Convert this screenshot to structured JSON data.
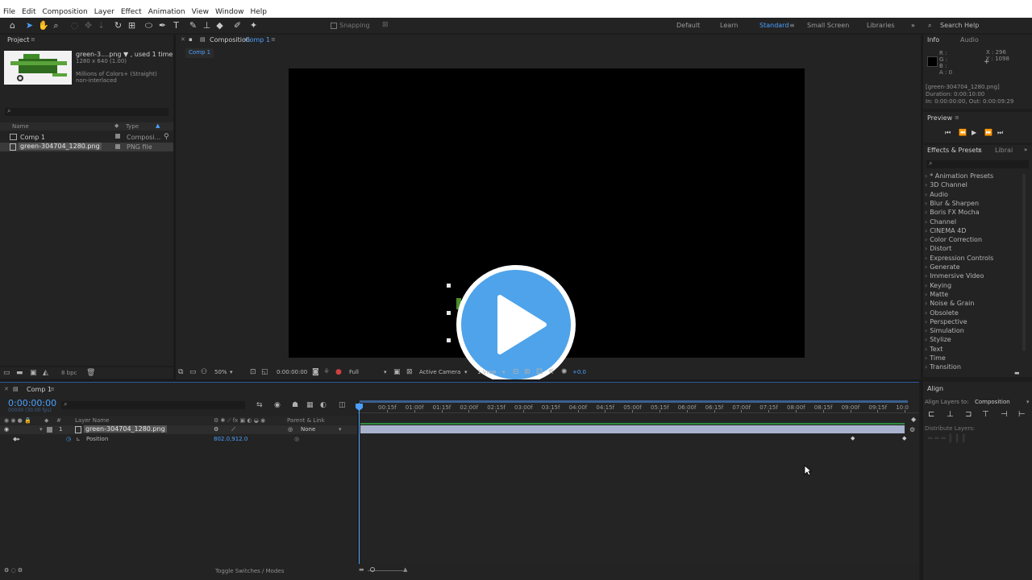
{
  "menu": [
    "File",
    "Edit",
    "Composition",
    "Layer",
    "Effect",
    "Animation",
    "View",
    "Window",
    "Help"
  ],
  "toolbar": {
    "snapping": "Snapping",
    "workspaces": [
      "Default",
      "Learn",
      "Standard",
      "Small Screen",
      "Libraries"
    ],
    "search_help": "Search Help"
  },
  "project": {
    "tab": "Project",
    "item_name": "green-3....png ▼ , used 1 time",
    "item_dims": "1280 x 640 (1.00)",
    "item_colors": "Millions of Colors+ (Straight)",
    "item_interlace": "non-interlaced",
    "col_name": "Name",
    "col_type": "Type",
    "items": [
      {
        "name": "Comp 1",
        "type": "Composi..."
      },
      {
        "name": "green-304704_1280.png",
        "type": "PNG file"
      }
    ],
    "bpc": "8 bpc"
  },
  "composition": {
    "tab_prefix": "Composition",
    "tab_name": "Comp 1",
    "breadcrumb": "Comp 1",
    "zoom": "50%",
    "timecode": "0:00:00:00",
    "resolution": "Full",
    "camera": "Active Camera",
    "view": "1 View",
    "exposure": "+0.0"
  },
  "info": {
    "tab_info": "Info",
    "tab_audio": "Audio",
    "r": "R :",
    "g": "G :",
    "b": "B :",
    "a": "A : 0",
    "x": "X : 296",
    "y": "Y : 1098",
    "file": "[green-304704_1280.png]",
    "duration": "Duration: 0:00:10:00",
    "inout": "In: 0:00:00:00, Out: 0:00:09:29"
  },
  "preview": {
    "tab": "Preview"
  },
  "effects": {
    "tab": "Effects & Presets",
    "tab2": "Librai",
    "items": [
      "* Animation Presets",
      "3D Channel",
      "Audio",
      "Blur & Sharpen",
      "Boris FX Mocha",
      "Channel",
      "CINEMA 4D",
      "Color Correction",
      "Distort",
      "Expression Controls",
      "Generate",
      "Immersive Video",
      "Keying",
      "Matte",
      "Noise & Grain",
      "Obsolete",
      "Perspective",
      "Simulation",
      "Stylize",
      "Text",
      "Time",
      "Transition"
    ]
  },
  "align": {
    "tab": "Align",
    "align_to_label": "Align Layers to:",
    "align_to_value": "Composition",
    "distribute": "Distribute Layers:"
  },
  "timeline": {
    "tab": "Comp 1",
    "timecode": "0:00:00:00",
    "timecode_sub": "00000 (30.00 fps)",
    "col_layer_name": "Layer Name",
    "col_parent": "Parent & Link",
    "layer_index": "1",
    "layer_name": "green-304704_1280.png",
    "parent_value": "None",
    "prop_name": "Position",
    "prop_value": "802.0,912.0",
    "ruler": [
      "00:15f",
      "01:00f",
      "01:15f",
      "02:00f",
      "02:15f",
      "03:00f",
      "03:15f",
      "04:00f",
      "04:15f",
      "05:00f",
      "05:15f",
      "06:00f",
      "06:15f",
      "07:00f",
      "07:15f",
      "08:00f",
      "08:15f",
      "09:00f",
      "09:15f",
      "10:0"
    ],
    "toggle_label": "Toggle Switches / Modes"
  },
  "colors": {
    "accent": "#2d8ceb",
    "play_button": "#4ea3ea",
    "layer_bar": "#a9b3cd",
    "selection": "#3a3a3a"
  }
}
